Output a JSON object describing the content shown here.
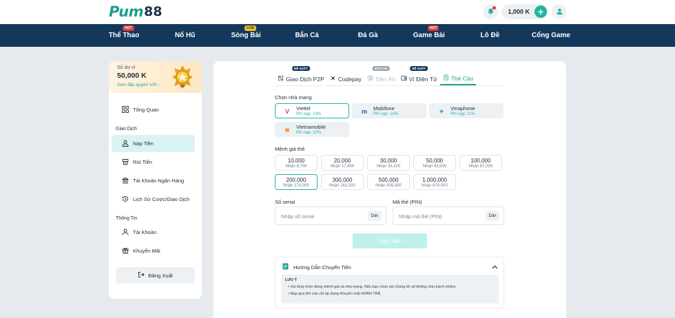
{
  "header": {
    "logo_mark": "Pum",
    "logo_num": "88",
    "balance": "1,000 K",
    "plus_label": "+"
  },
  "nav": [
    {
      "label": "Thể Thao",
      "badge": "HOT",
      "badge_type": "hot"
    },
    {
      "label": "Nổ Hũ",
      "badge": "",
      "badge_type": ""
    },
    {
      "label": "Sòng Bài",
      "badge": "LIVE",
      "badge_type": "live"
    },
    {
      "label": "Bắn Cá",
      "badge": "",
      "badge_type": ""
    },
    {
      "label": "Đá Gà",
      "badge": "",
      "badge_type": ""
    },
    {
      "label": "Game Bài",
      "badge": "HOT",
      "badge_type": "hot"
    },
    {
      "label": "Lô Đề",
      "badge": "",
      "badge_type": ""
    },
    {
      "label": "Cổng Game",
      "badge": "",
      "badge_type": ""
    }
  ],
  "sidebar": {
    "balance_label": "Số dư ví",
    "balance_value": "50,000 K",
    "vip_link": "Xem đặc quyền VIP",
    "vip_badge": "VIP",
    "overview": "Tổng Quan",
    "section_transactions": "Giao Dịch",
    "deposit": "Nạp Tiền",
    "withdraw": "Rút Tiền",
    "bank_account": "Tài Khoản Ngân Hàng",
    "history": "Lịch Sử Cược/Giao Dịch",
    "section_info": "Thông Tin",
    "account": "Tài Khoản",
    "promotions": "Khuyến Mãi",
    "logout": "Đăng Xuất"
  },
  "tabs": [
    {
      "label": "Giao Dịch P2P",
      "badge": "ĐỀ XUẤT",
      "state": "normal"
    },
    {
      "label": "Codepay",
      "badge": "",
      "state": "normal"
    },
    {
      "label": "Tiền Ảo",
      "badge": "BẢO TRÌ",
      "state": "disabled"
    },
    {
      "label": "Ví Điện Tử",
      "badge": "ĐỀ XUẤT",
      "state": "normal"
    },
    {
      "label": "Thẻ Cào",
      "badge": "",
      "state": "active"
    }
  ],
  "form": {
    "carrier_label": "Chọn nhà mạng",
    "carriers": [
      {
        "name": "Viettel",
        "fee": "Phí nạp: 13%"
      },
      {
        "name": "Mobifone",
        "fee": "Phí nạp: 14%"
      },
      {
        "name": "Vinaphone",
        "fee": "Phí nạp: 11%"
      },
      {
        "name": "Vietnamobile",
        "fee": "Phí nạp: 10%"
      }
    ],
    "denom_label": "Mệnh giá thẻ",
    "denoms": [
      {
        "value": "10,000",
        "receive": "Nhận 8,700"
      },
      {
        "value": "20,000",
        "receive": "Nhận 17,400"
      },
      {
        "value": "30,000",
        "receive": "Nhận 26,100"
      },
      {
        "value": "50,000",
        "receive": "Nhận 43,500"
      },
      {
        "value": "100,000",
        "receive": "Nhận 87,000"
      },
      {
        "value": "200,000",
        "receive": "Nhận 174,000"
      },
      {
        "value": "300,000",
        "receive": "Nhận 261,000"
      },
      {
        "value": "500,000",
        "receive": "Nhận 435,000"
      },
      {
        "value": "1,000,000",
        "receive": "Nhận 870,000"
      }
    ],
    "serial_label": "Số serial",
    "serial_placeholder": "Nhập số serial",
    "pin_label": "Mã thẻ (PIN)",
    "pin_placeholder": "Nhập mã thẻ (PIN)",
    "paste_label": "Dán",
    "submit_label": "Nạp Tiền"
  },
  "guide": {
    "title": "Hướng Dẫn Chuyển Tiền",
    "note_title": "LƯU Ý",
    "lines": [
      "• Vui lòng chọn đúng mệnh giá và nhà mạng. Nếu bạn chọn sai chúng tôi sẽ không chịu trách nhiệm.",
      "• Nạp qua thẻ cào chỉ áp dụng Khuyến mãi HOÀN TRẢ."
    ]
  },
  "colors": {
    "accent": "#1fb5a3",
    "nav_bg": "#13385c",
    "hot": "#e23b3b",
    "live": "#f4c22b"
  }
}
